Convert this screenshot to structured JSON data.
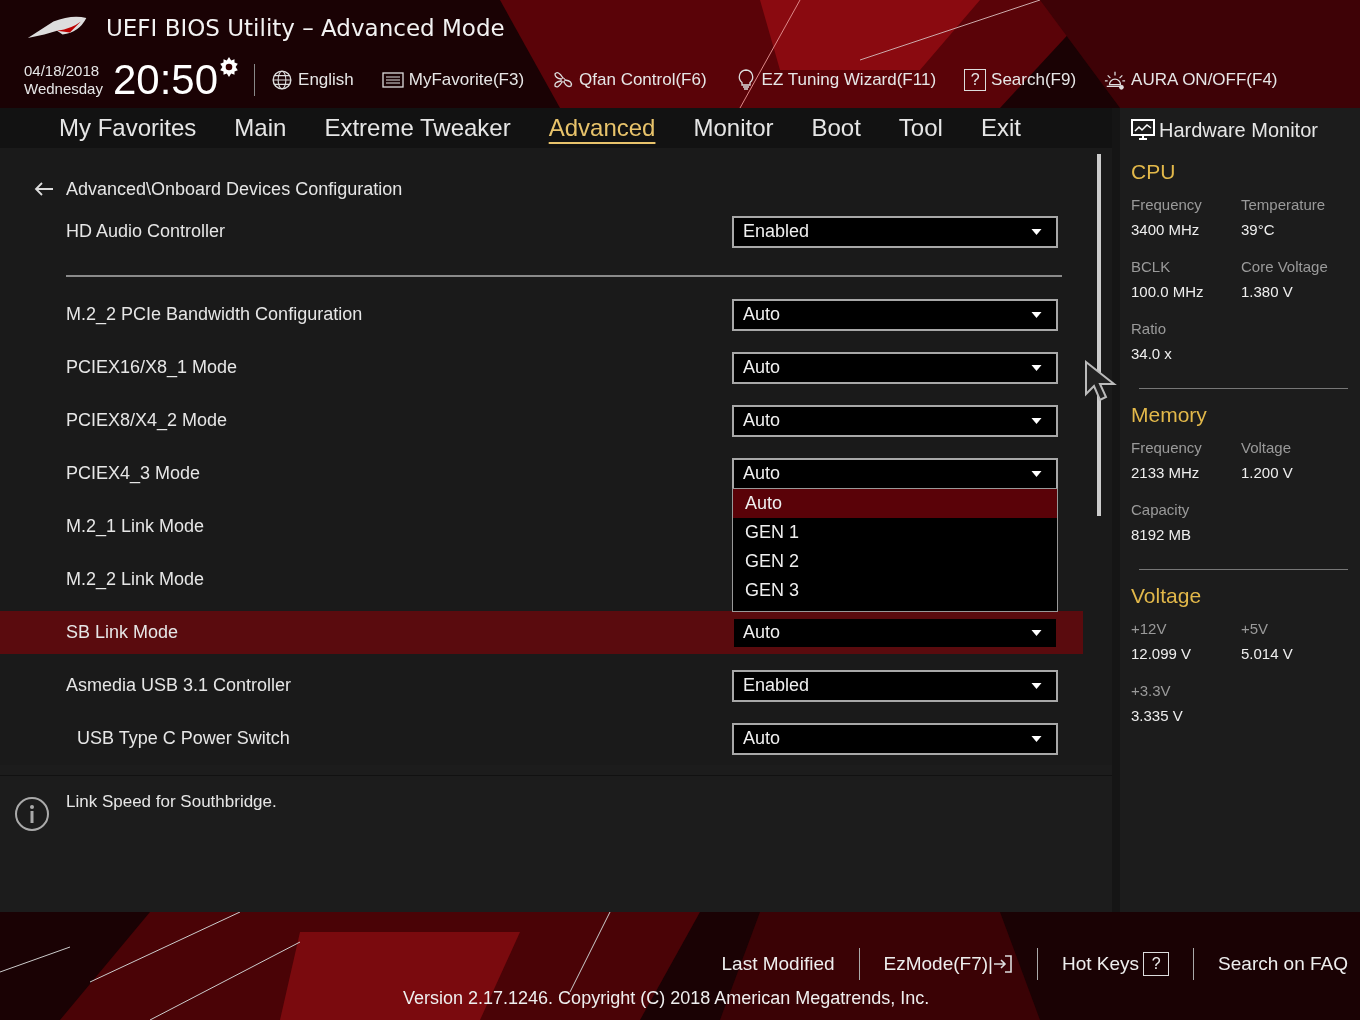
{
  "window": {
    "title": "UEFI BIOS Utility – Advanced Mode"
  },
  "clock": {
    "date": "04/18/2018",
    "day": "Wednesday",
    "time": "20:50"
  },
  "toolbar": [
    {
      "label": "English",
      "kind": "language"
    },
    {
      "label": "MyFavorite(F3)",
      "kind": "favorite"
    },
    {
      "label": "Qfan Control(F6)",
      "kind": "fan"
    },
    {
      "label": "EZ Tuning Wizard(F11)",
      "kind": "wizard"
    },
    {
      "label": "Search(F9)",
      "kind": "search",
      "glyph": "?"
    },
    {
      "label": "AURA ON/OFF(F4)",
      "kind": "aura"
    }
  ],
  "tabs": [
    {
      "label": "My Favorites",
      "selected": false
    },
    {
      "label": "Main",
      "selected": false
    },
    {
      "label": "Extreme Tweaker",
      "selected": false
    },
    {
      "label": "Advanced",
      "selected": true
    },
    {
      "label": "Monitor",
      "selected": false
    },
    {
      "label": "Boot",
      "selected": false
    },
    {
      "label": "Tool",
      "selected": false
    },
    {
      "label": "Exit",
      "selected": false
    }
  ],
  "breadcrumb": "Advanced\\Onboard Devices Configuration",
  "settings": [
    {
      "kind": "setting",
      "label": "HD Audio Controller",
      "value": "Enabled",
      "selected": false
    },
    {
      "kind": "divider"
    },
    {
      "kind": "setting",
      "label": "M.2_2 PCIe Bandwidth Configuration",
      "value": "Auto",
      "selected": false
    },
    {
      "kind": "setting",
      "label": "PCIEX16/X8_1 Mode",
      "value": "Auto",
      "selected": false
    },
    {
      "kind": "setting",
      "label": "PCIEX8/X4_2 Mode",
      "value": "Auto",
      "selected": false
    },
    {
      "kind": "setting",
      "label": "PCIEX4_3 Mode",
      "value": "Auto",
      "selected": false,
      "options": [
        {
          "label": "Auto",
          "selected": true
        },
        {
          "label": "GEN 1",
          "selected": false
        },
        {
          "label": "GEN 2",
          "selected": false
        },
        {
          "label": "GEN 3",
          "selected": false
        }
      ]
    },
    {
      "kind": "setting",
      "label": "M.2_1 Link Mode",
      "selected": false
    },
    {
      "kind": "setting",
      "label": "M.2_2 Link Mode",
      "selected": false
    },
    {
      "kind": "setting",
      "label": "SB Link Mode",
      "value": "Auto",
      "selected": true
    },
    {
      "kind": "setting",
      "label": "Asmedia USB 3.1 Controller",
      "value": "Enabled",
      "selected": false,
      "children": [
        {
          "kind": "setting",
          "label": "USB Type C Power Switch",
          "value": "Auto",
          "selected": false
        }
      ]
    }
  ],
  "help": "Link Speed for Southbridge.",
  "hardware_monitor": {
    "title": "Hardware Monitor",
    "sections": [
      {
        "title": "CPU",
        "items": [
          {
            "label": "Frequency",
            "value": "3400 MHz"
          },
          {
            "label": "Temperature",
            "value": "39°C"
          },
          {
            "label": "BCLK",
            "value": "100.0 MHz"
          },
          {
            "label": "Core Voltage",
            "value": "1.380 V"
          },
          {
            "label": "Ratio",
            "value": "34.0 x"
          }
        ]
      },
      {
        "title": "Memory",
        "items": [
          {
            "label": "Frequency",
            "value": "2133 MHz"
          },
          {
            "label": "Voltage",
            "value": "1.200 V"
          },
          {
            "label": "Capacity",
            "value": "8192 MB"
          }
        ]
      },
      {
        "title": "Voltage",
        "items": [
          {
            "label": "+12V",
            "value": "12.099 V"
          },
          {
            "label": "+5V",
            "value": "5.014 V"
          },
          {
            "label": "+3.3V",
            "value": "3.335 V"
          }
        ]
      }
    ]
  },
  "footer": {
    "links": [
      {
        "label": "Last Modified",
        "kind": "text"
      },
      {
        "label": "EzMode(F7)|",
        "kind": "exit"
      },
      {
        "label": "Hot Keys",
        "kind": "keys",
        "glyph": "?"
      },
      {
        "label": "Search on FAQ",
        "kind": "text"
      }
    ],
    "version": "Version 2.17.1246. Copyright (C) 2018 American Megatrends, Inc."
  }
}
